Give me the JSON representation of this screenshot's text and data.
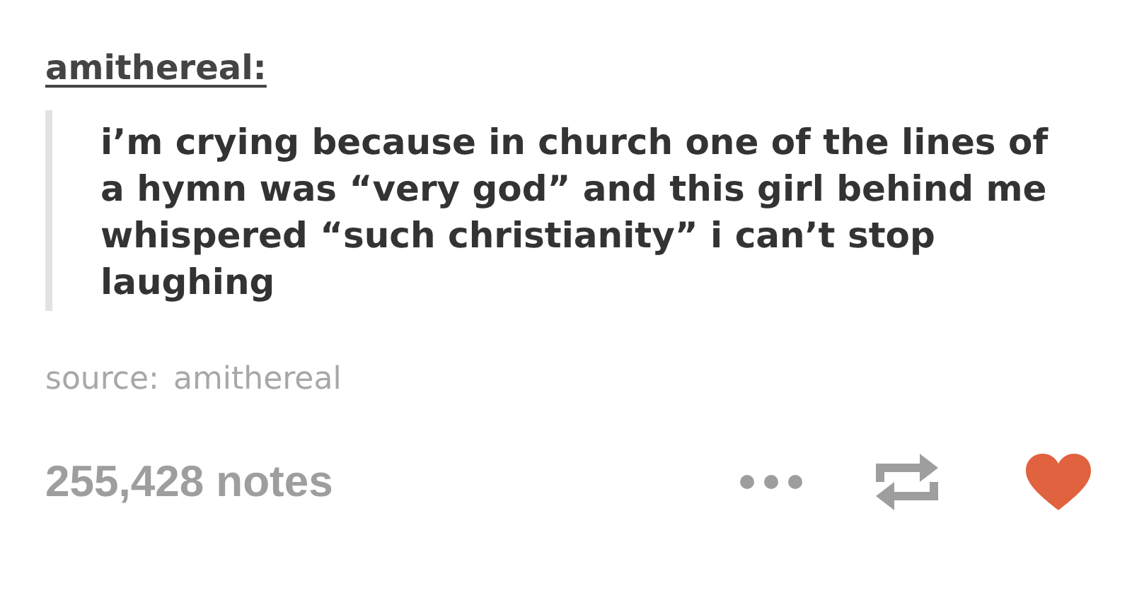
{
  "post": {
    "username": "amithereal:",
    "quote": "i’m crying because in church one of the lines of a hymn was “very god” and this girl behind me whispered “such christianity” i can’t stop laughing",
    "source_label": "source:",
    "source_link": "amithereal"
  },
  "footer": {
    "notes": "255,428 notes",
    "liked": true
  }
}
